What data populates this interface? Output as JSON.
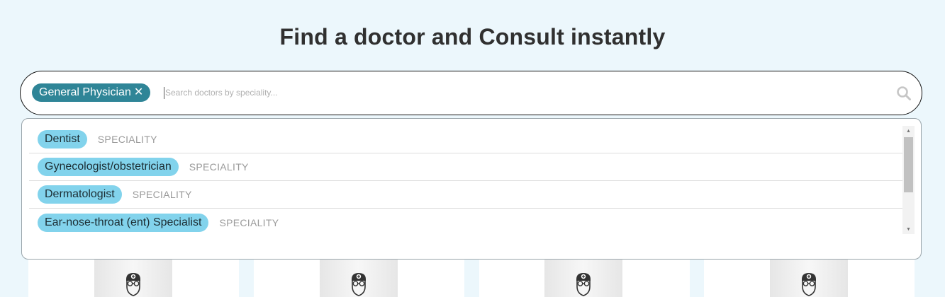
{
  "page": {
    "title": "Find a doctor and Consult instantly"
  },
  "search": {
    "selected_chip": "General Physician",
    "chip_close_glyph": "✕",
    "placeholder": "Search doctors by speciality...",
    "value": "",
    "icon": "search-icon"
  },
  "dropdown": {
    "items": [
      {
        "label": "Dentist",
        "type": "SPECIALITY"
      },
      {
        "label": "Gynecologist/obstetrician",
        "type": "SPECIALITY"
      },
      {
        "label": "Dermatologist",
        "type": "SPECIALITY"
      },
      {
        "label": "Ear-nose-throat (ent) Specialist",
        "type": "SPECIALITY"
      }
    ]
  },
  "scrollbar": {
    "up_glyph": "▲",
    "down_glyph": "▼"
  },
  "cards": [
    {
      "icon": "doctor-avatar-icon"
    },
    {
      "icon": "doctor-avatar-icon"
    },
    {
      "icon": "doctor-avatar-icon"
    },
    {
      "icon": "doctor-avatar-icon"
    }
  ],
  "colors": {
    "background": "#ecf7fc",
    "selected_chip": "#2f8597",
    "speciality_chip": "#82d3ec",
    "title_text": "#303030"
  }
}
